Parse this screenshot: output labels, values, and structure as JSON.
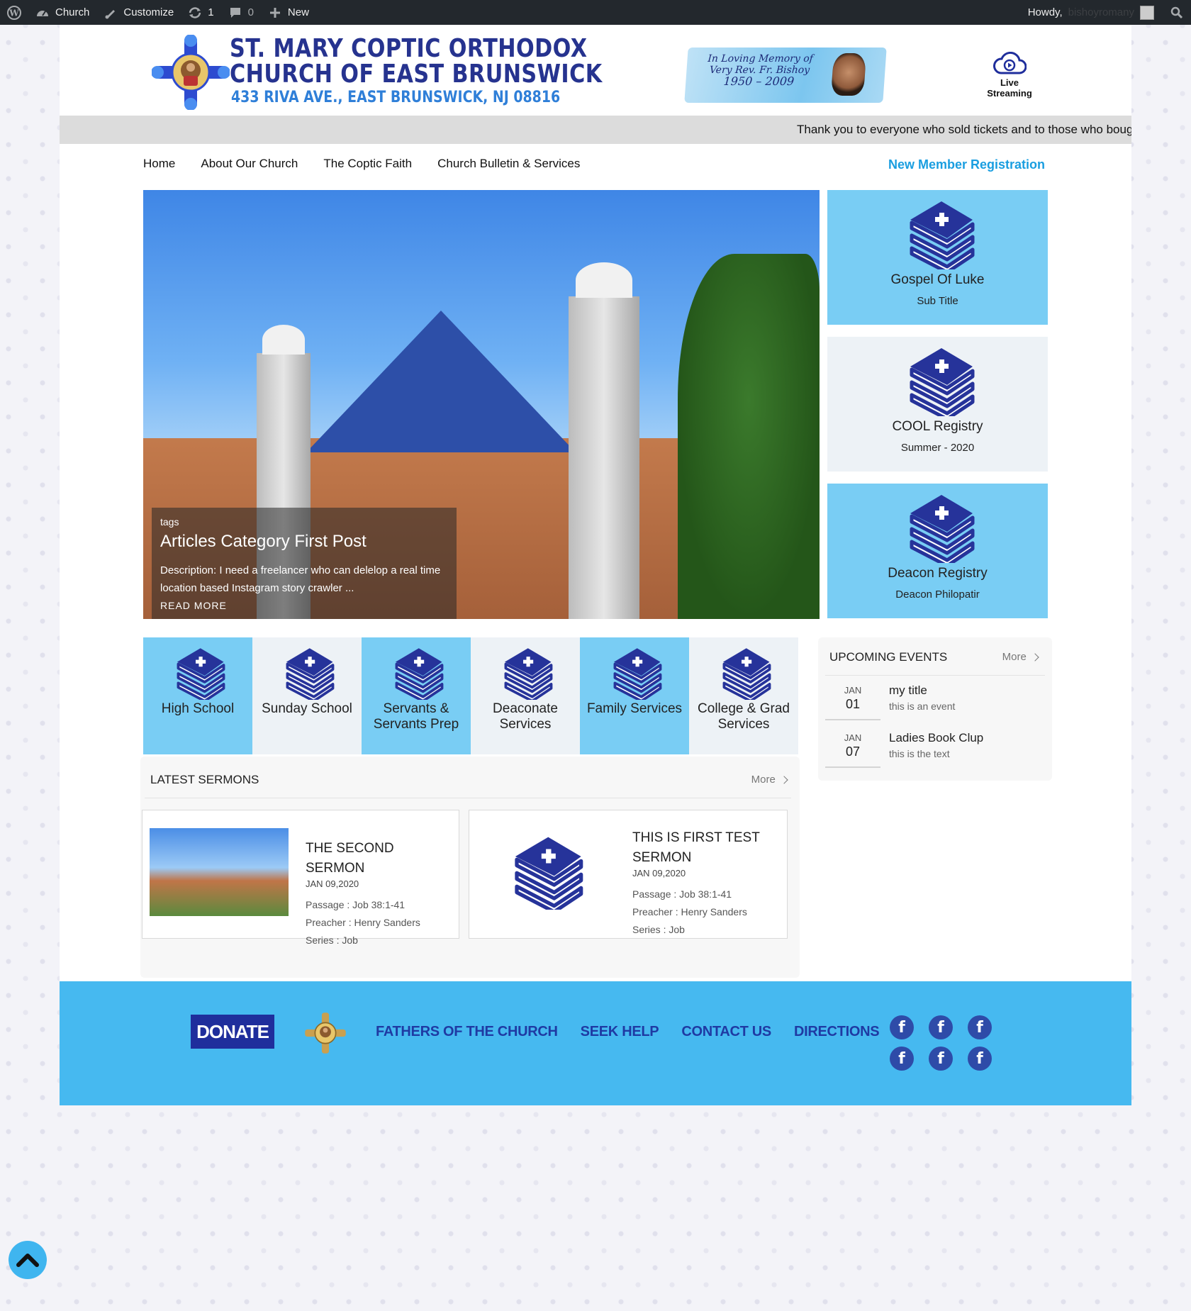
{
  "admin_bar": {
    "site_name": "Church",
    "customize": "Customize",
    "updates_count": "1",
    "comments_count": "0",
    "new_label": "New",
    "howdy": "Howdy,",
    "username": "bishoyromany"
  },
  "header": {
    "title_line1": "ST. MARY COPTIC ORTHODOX",
    "title_line2": "CHURCH OF EAST BRUNSWICK",
    "address": "433 RIVA AVE., EAST BRUNSWICK, NJ 08816",
    "memorial_line1": "In Loving Memory of",
    "memorial_line2": "Very Rev. Fr. Bishoy",
    "memorial_line3": "1950 – 2009",
    "live_line1": "Live",
    "live_line2": "Streaming"
  },
  "ticker": {
    "text": "Thank you to everyone who sold tickets and to those who bough"
  },
  "nav": {
    "items": [
      "Home",
      "About Our Church",
      "The Coptic Faith",
      "Church Bulletin & Services"
    ],
    "registration": "New Member Registration"
  },
  "hero": {
    "tags": "tags",
    "title": "Articles Category First Post",
    "description": "Description: I need a freelancer who can delelop a real time location based Instagram story crawler ...",
    "read_more": "READ MORE"
  },
  "side_cards": [
    {
      "title": "Gospel Of Luke",
      "subtitle": "Sub Title",
      "bg": "#79cdf4"
    },
    {
      "title": "COOL Registry",
      "subtitle": "Summer - 2020",
      "bg": "#edf2f6"
    },
    {
      "title": "Deacon Registry",
      "subtitle": "Deacon Philopatir",
      "bg": "#79cdf4"
    }
  ],
  "ministries": [
    {
      "label": "High School",
      "bg": "#79cdf4"
    },
    {
      "label": "Sunday School",
      "bg": "#edf2f6"
    },
    {
      "label": "Servants & Servants Prep",
      "bg": "#79cdf4"
    },
    {
      "label": "Deaconate Services",
      "bg": "#edf2f6"
    },
    {
      "label": "Family Services",
      "bg": "#79cdf4"
    },
    {
      "label": "College & Grad Services",
      "bg": "#edf2f6"
    }
  ],
  "events": {
    "heading": "UPCOMING EVENTS",
    "more": "More",
    "items": [
      {
        "month": "JAN",
        "day": "01",
        "title": "my title",
        "text": "this is an event"
      },
      {
        "month": "JAN",
        "day": "07",
        "title": "Ladies Book Clup",
        "text": "this is the text"
      }
    ]
  },
  "sermons": {
    "heading": "LATEST SERMONS",
    "more": "More",
    "items": [
      {
        "title": "THE SECOND SERMON",
        "date": "JAN 09,2020",
        "passage": "Passage : Job 38:1-41",
        "preacher": "Preacher : Henry Sanders",
        "series": "Series : Job"
      },
      {
        "title": "THIS IS FIRST TEST SERMON",
        "date": "JAN 09,2020",
        "passage": "Passage : Job 38:1-41",
        "preacher": "Preacher : Henry Sanders",
        "series": "Series : Job"
      }
    ]
  },
  "footer": {
    "donate": "DONATE",
    "links": [
      "FATHERS OF THE CHURCH",
      "SEEK HELP",
      "CONTACT US",
      "DIRECTIONS"
    ],
    "social_icon": "facebook-icon",
    "social_glyph": "f"
  },
  "colors": {
    "accent_blue": "#79cdf4",
    "footer_blue": "#46b9f0",
    "navy": "#26338f",
    "link_blue": "#1a9ee0"
  }
}
